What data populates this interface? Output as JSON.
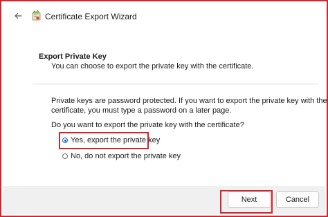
{
  "window": {
    "title": "Certificate Export Wizard",
    "back_icon": "back-arrow-icon",
    "app_icon": "certificate-wizard-icon"
  },
  "header": {
    "heading": "Export Private Key",
    "description": "You can choose to export the private key with the certificate."
  },
  "body": {
    "info_line1": "Private keys are password protected. If you want to export the private key with the",
    "info_line2": "certificate, you must type a password on a later page.",
    "question": "Do you want to export the private key with the certificate?",
    "options": [
      {
        "label": "Yes, export the private key",
        "selected": true
      },
      {
        "label": "No, do not export the private key",
        "selected": false
      }
    ]
  },
  "footer": {
    "next_label": "Next",
    "cancel_label": "Cancel"
  },
  "colors": {
    "highlight": "#d6222c",
    "radio_accent": "#0f5cc2"
  }
}
